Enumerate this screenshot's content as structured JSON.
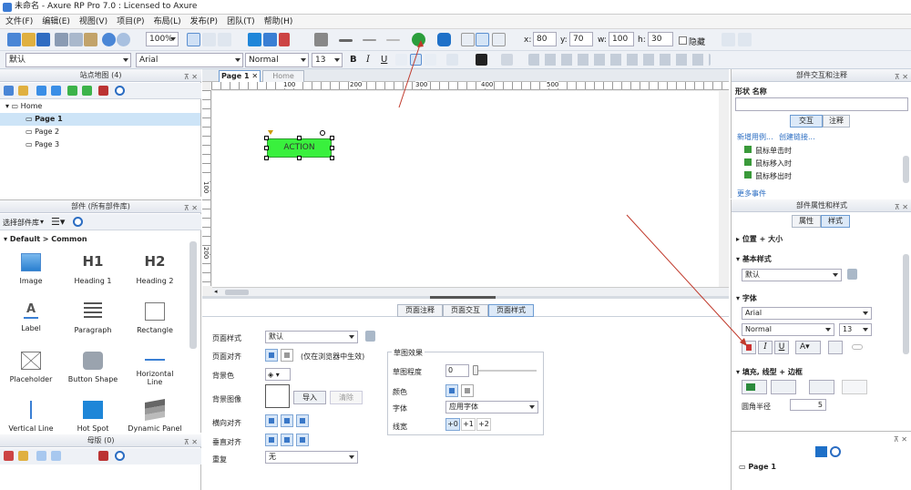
{
  "titlebar": {
    "title": "未命名 - Axure RP Pro 7.0 : Licensed to Axure"
  },
  "menu": [
    "文件(F)",
    "编辑(E)",
    "视图(V)",
    "项目(P)",
    "布局(L)",
    "发布(P)",
    "团队(T)",
    "帮助(H)"
  ],
  "toolbar": {
    "zoom": "100%",
    "x_label": "x:",
    "x": "80",
    "y_label": "y:",
    "y": "70",
    "w_label": "w:",
    "w": "100",
    "h_label": "h:",
    "h": "30",
    "hide_label": "隐藏"
  },
  "toolbar2": {
    "style": "默认",
    "font": "Arial",
    "weight": "Normal",
    "size": "13",
    "bold": "B",
    "italic": "I",
    "underline": "U"
  },
  "sitemap": {
    "title": "站点地图 (4)",
    "pages": [
      "Home",
      "Page 1",
      "Page 2",
      "Page 3"
    ],
    "selected": "Page 1"
  },
  "widgets": {
    "title": "部件 (所有部件库)",
    "select_label": "选择部件库",
    "group": "Default > Common",
    "items": [
      "Image",
      "Heading 1",
      "Heading 2",
      "Label",
      "Paragraph",
      "Rectangle",
      "Placeholder",
      "Button Shape",
      "Horizontal Line",
      "Vertical Line",
      "Hot Spot",
      "Dynamic Panel"
    ],
    "h1": "H1",
    "h2": "H2"
  },
  "masters": {
    "title": "母版 (0)"
  },
  "canvas": {
    "tabs": [
      "Page 1",
      "Home"
    ],
    "ruler_top": [
      "100",
      "200",
      "300",
      "400",
      "500"
    ],
    "ruler_left": [
      "100",
      "200"
    ],
    "button_text": "ACTION",
    "button_color": "#39f03d"
  },
  "pageprops": {
    "tabs": [
      "页面注释",
      "页面交互",
      "页面样式"
    ],
    "active_tab": "页面样式",
    "page_style_label": "页面样式",
    "page_style_value": "默认",
    "page_align_label": "页面对齐",
    "page_align_note": "(仅在浏览器中生效)",
    "bgcolor_label": "背景色",
    "bgimage_label": "背景图像",
    "import_btn": "导入",
    "clear_btn": "清除",
    "halign_label": "横向对齐",
    "valign_label": "垂直对齐",
    "repeat_label": "重复",
    "repeat_value": "无",
    "sketch_title": "草图效果",
    "sketch_level_label": "草图程度",
    "sketch_level": "0",
    "color_label": "颜色",
    "font_label": "字体",
    "font_value": "应用字体",
    "line_label": "线宽",
    "line_opts": [
      "+0",
      "+1",
      "+2"
    ]
  },
  "interactions": {
    "title": "部件交互和注释",
    "shape_label": "形状",
    "name_label": "名称",
    "tabs": [
      "交互",
      "注释"
    ],
    "new_case": "新增用例...",
    "create_link": "创建链接...",
    "events": [
      "鼠标单击时",
      "鼠标移入时",
      "鼠标移出时"
    ],
    "more": "更多事件"
  },
  "styleprops": {
    "title": "部件属性和样式",
    "tabs": [
      "属性",
      "样式"
    ],
    "pos_size": "位置 + 大小",
    "base_style": "基本样式",
    "base_style_value": "默认",
    "font_title": "字体",
    "font": "Arial",
    "weight": "Normal",
    "size": "13",
    "fill_title": "填充, 线型 + 边框",
    "radius_label": "圆角半径",
    "radius": "5"
  },
  "outline": {
    "page": "Page 1"
  }
}
